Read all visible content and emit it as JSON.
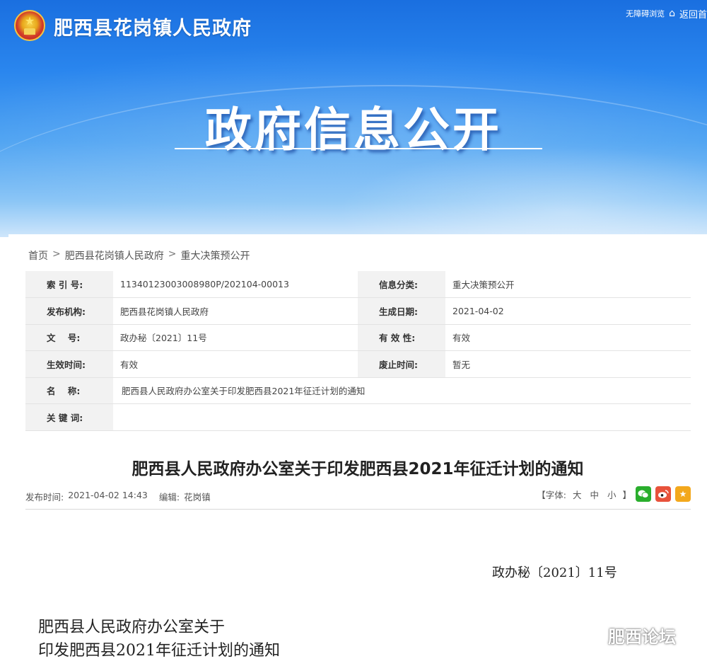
{
  "header": {
    "site_title": "肥西县花岗镇人民政府",
    "accessibility_link": "无障碍浏览",
    "home_link": "返回首",
    "banner_heading": "政府信息公开"
  },
  "breadcrumb": {
    "items": [
      "首页",
      "肥西县花岗镇人民政府",
      "重大决策预公开"
    ],
    "separator": ">"
  },
  "meta": {
    "rows": [
      {
        "label1": "索 引 号:",
        "value1": "11340123003008980P/202104-00013",
        "label2": "信息分类:",
        "value2": "重大决策预公开"
      },
      {
        "label1": "发布机构:",
        "value1": "肥西县花岗镇人民政府",
        "label2": "生成日期:",
        "value2": "2021-04-02"
      },
      {
        "label1": "文    号:",
        "value1": "政办秘〔2021〕11号",
        "label2": "有 效 性:",
        "value2": "有效"
      },
      {
        "label1": "生效时间:",
        "value1": "有效",
        "label2": "废止时间:",
        "value2": "暂无"
      }
    ],
    "name_label": "名    称:",
    "name_value": "肥西县人民政府办公室关于印发肥西县2021年征迁计划的通知",
    "keyword_label": "关 键 词:",
    "keyword_value": ""
  },
  "article": {
    "title": "肥西县人民政府办公室关于印发肥西县2021年征迁计划的通知",
    "publish_label": "发布时间:",
    "publish_time": "2021-04-02 14:43",
    "editor_label": "编辑:",
    "editor": "花岗镇",
    "font_label_open": "【字体:",
    "font_large": "大",
    "font_medium": "中",
    "font_small": "小",
    "font_label_close": "】",
    "doc_number": "政办秘〔2021〕11号",
    "heading_line1": "肥西县人民政府办公室关于",
    "heading_line2": "印发肥西县2021年征迁计划的通知"
  },
  "watermark": {
    "text": "肥西论坛"
  },
  "icons": {
    "emblem": "national-emblem-icon",
    "home": "home-icon",
    "wechat": "wechat-share-icon",
    "weibo": "weibo-share-icon",
    "favorite": "favorite-star-icon"
  },
  "colors": {
    "banner_blue": "#2a86ee",
    "wechat_green": "#2aae2d",
    "weibo_red": "#e8523b",
    "favorite_orange": "#f3a81c"
  }
}
